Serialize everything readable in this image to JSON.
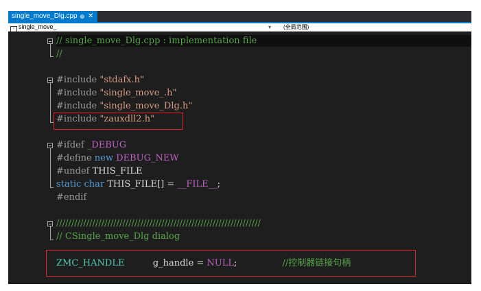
{
  "tab": {
    "label": "single_move_Dlg.cpp",
    "pin": "⊕",
    "close": "✕"
  },
  "navbar": {
    "scope": "single_move_",
    "dropdown": "▾",
    "member": "(全局范围)"
  },
  "code": {
    "l1": {
      "comment": "// single_move_Dlg.cpp : implementation file"
    },
    "l2": {
      "comment": "//"
    },
    "l3": {
      "directive": "#include",
      "string": "\"stdafx.h\""
    },
    "l4": {
      "directive": "#include",
      "string": "\"single_move_.h\""
    },
    "l5": {
      "directive": "#include",
      "string": "\"single_move_Dlg.h\""
    },
    "l6": {
      "directive": "#include",
      "string": "\"zauxdll2.h\""
    },
    "l7": {
      "directive": "#ifdef",
      "macro": "_DEBUG"
    },
    "l8": {
      "directive": "#define",
      "keyword": "new",
      "macro": "DEBUG_NEW"
    },
    "l9": {
      "directive": "#undef",
      "ident": "THIS_FILE"
    },
    "l10": {
      "kw1": "static",
      "kw2": "char",
      "ident": "THIS_FILE[] = ",
      "macro": "__FILE__",
      "end": ";"
    },
    "l11": {
      "directive": "#endif"
    },
    "l12": {
      "comment": "////////////////////////////////////////////////////////////////////"
    },
    "l13": {
      "comment": "// CSingle_move_Dlg dialog"
    },
    "l14": {
      "type": "ZMC_HANDLE",
      "ident": "g_handle = ",
      "macro": "NULL",
      "end": ";",
      "comment": "//控制器链接句柄"
    }
  },
  "colors": {
    "accent": "#007acc",
    "background": "#1e1e1e",
    "comment": "#57a64a",
    "string": "#d69d85",
    "macro": "#bd63c5",
    "keyword": "#569cd6",
    "highlight_box": "#e0262d"
  }
}
